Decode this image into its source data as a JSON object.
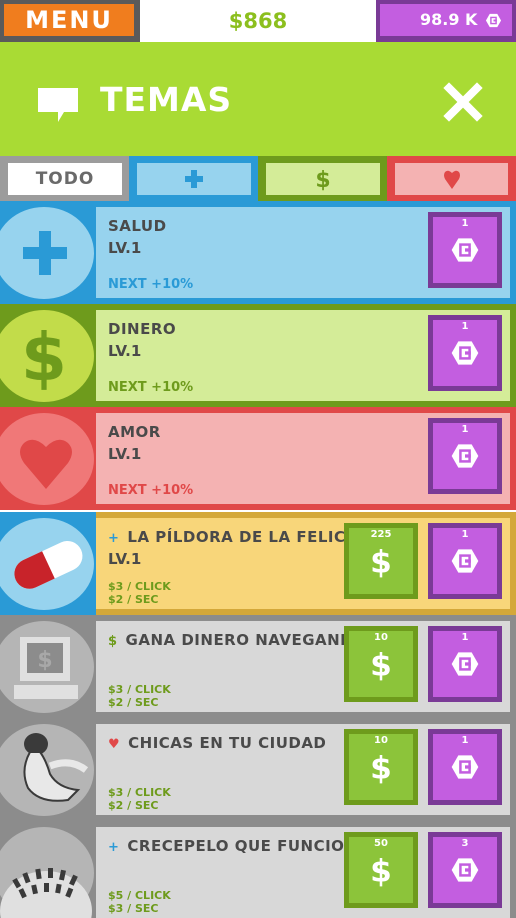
{
  "topbar": {
    "menu_label": "MENU",
    "money": "$868",
    "coins": "98.9 K"
  },
  "header": {
    "title": "TEMAS",
    "icon": "chat-bubble-icon",
    "close_icon": "close-icon"
  },
  "tabs": [
    {
      "label": "TODO",
      "selected": true
    },
    {
      "label": "",
      "icon": "plus-icon",
      "color": "#2a9ad6"
    },
    {
      "label": "",
      "icon": "dollar-icon",
      "color": "#6e9b1c"
    },
    {
      "label": "",
      "icon": "heart-icon",
      "color": "#e04848"
    }
  ],
  "colors": {
    "salud": "#2a9ad6",
    "dinero": "#6e9b1c",
    "amor": "#e04848",
    "coin": "#c35ee0",
    "cash": "#8cc43a",
    "header": "#a9db34",
    "menu": "#f07d1e"
  },
  "topics": [
    {
      "name": "SALUD",
      "level": "LV.1",
      "next": "NEXT +10%",
      "coin_price": "1"
    },
    {
      "name": "DINERO",
      "level": "LV.1",
      "next": "NEXT +10%",
      "coin_price": "1"
    },
    {
      "name": "AMOR",
      "level": "LV.1",
      "next": "NEXT +10%",
      "coin_price": "1"
    }
  ],
  "items": [
    {
      "name": "LA PÍLDORA DE LA FELICIDAD",
      "category": "salud",
      "mark": "+",
      "level": "LV.1",
      "per_click": "$3 / CLICK",
      "per_sec": "$2 / SEC",
      "cash_price": "225",
      "coin_price": "1",
      "icon": "pill-icon"
    },
    {
      "name": "GANA DINERO NAVEGANDO",
      "category": "dinero",
      "mark": "$",
      "level": "",
      "per_click": "$3 / CLICK",
      "per_sec": "$2 / SEC",
      "cash_price": "10",
      "coin_price": "1",
      "icon": "computer-icon"
    },
    {
      "name": "CHICAS EN TU CIUDAD",
      "category": "amor",
      "mark": "♥",
      "level": "",
      "per_click": "$3 / CLICK",
      "per_sec": "$2 / SEC",
      "cash_price": "10",
      "coin_price": "1",
      "icon": "woman-icon"
    },
    {
      "name": "CRECEPELO QUE FUNCIONA",
      "category": "salud",
      "mark": "+",
      "level": "",
      "per_click": "$5 / CLICK",
      "per_sec": "$3 / SEC",
      "cash_price": "50",
      "coin_price": "3",
      "icon": "hair-icon"
    }
  ]
}
